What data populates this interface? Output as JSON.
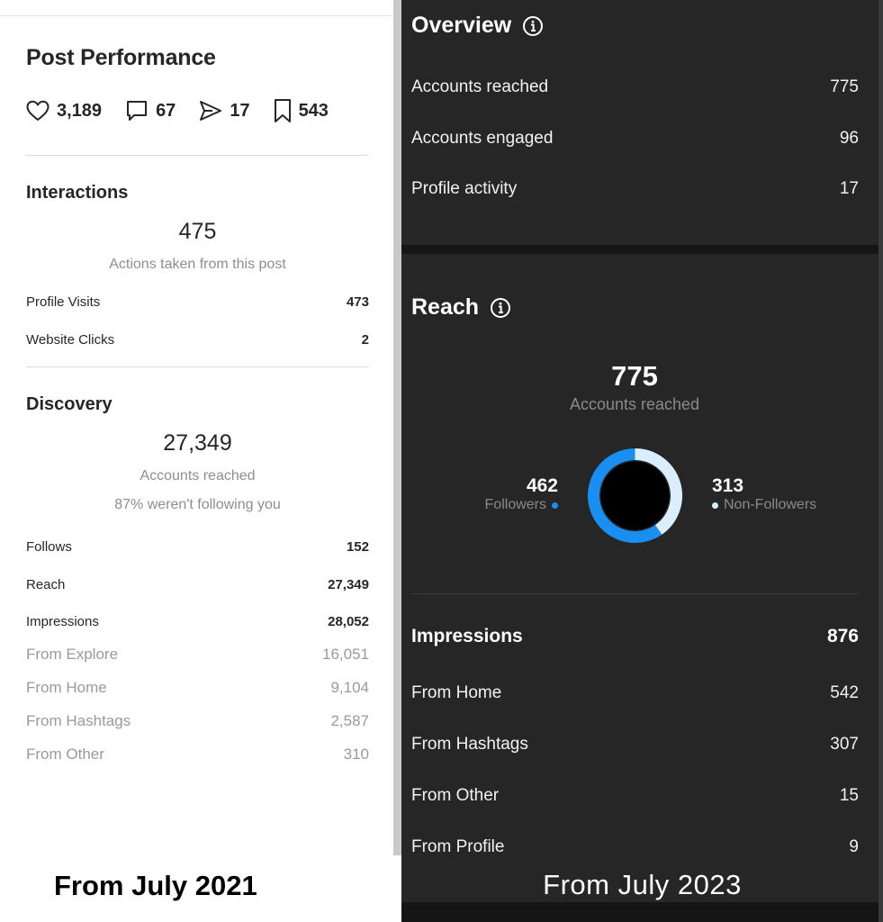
{
  "left": {
    "title": "Post Performance",
    "stats": {
      "likes": "3,189",
      "comments": "67",
      "shares": "17",
      "saves": "543"
    },
    "interactions": {
      "heading": "Interactions",
      "total": "475",
      "subtitle": "Actions taken from this post",
      "rows": [
        {
          "label": "Profile Visits",
          "value": "473"
        },
        {
          "label": "Website Clicks",
          "value": "2"
        }
      ]
    },
    "discovery": {
      "heading": "Discovery",
      "total": "27,349",
      "subtitle": "Accounts reached",
      "note": "87% weren't following you",
      "rows": [
        {
          "label": "Follows",
          "value": "152"
        },
        {
          "label": "Reach",
          "value": "27,349"
        },
        {
          "label": "Impressions",
          "value": "28,052"
        }
      ],
      "sources": [
        {
          "label": "From Explore",
          "value": "16,051"
        },
        {
          "label": "From Home",
          "value": "9,104"
        },
        {
          "label": "From Hashtags",
          "value": "2,587"
        },
        {
          "label": "From Other",
          "value": "310"
        }
      ]
    },
    "caption": "From July 2021"
  },
  "right": {
    "overview": {
      "heading": "Overview",
      "rows": [
        {
          "label": "Accounts reached",
          "value": "775"
        },
        {
          "label": "Accounts engaged",
          "value": "96"
        },
        {
          "label": "Profile activity",
          "value": "17"
        }
      ]
    },
    "reach": {
      "heading": "Reach",
      "total": "775",
      "subtitle": "Accounts reached",
      "followers": {
        "value": "462",
        "label": "Followers"
      },
      "non_followers": {
        "value": "313",
        "label": "Non-Followers"
      }
    },
    "impressions": {
      "label": "Impressions",
      "value": "876",
      "rows": [
        {
          "label": "From Home",
          "value": "542"
        },
        {
          "label": "From Hashtags",
          "value": "307"
        },
        {
          "label": "From Other",
          "value": "15"
        },
        {
          "label": "From Profile",
          "value": "9"
        }
      ]
    },
    "caption": "From July 2023"
  },
  "colors": {
    "followers": "#1b8ef2",
    "non_followers": "#dbeeff",
    "dark_card": "#262626",
    "light_text": "#262626",
    "muted": "#8e8e8e"
  },
  "chart_data": {
    "type": "pie",
    "title": "",
    "categories": [
      "Followers",
      "Non-Followers"
    ],
    "values": [
      462,
      313
    ]
  }
}
